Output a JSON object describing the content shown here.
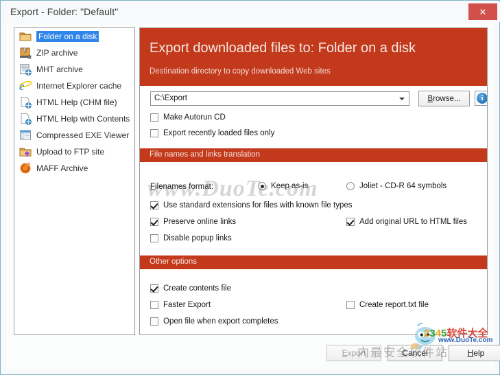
{
  "window": {
    "title": "Export - Folder: \"Default\"",
    "close_label": "✕",
    "accent_color": "#c3391c",
    "selection_color": "#2f86e8"
  },
  "sidebar": {
    "items": [
      {
        "label": "Folder on a disk",
        "icon": "folder-icon",
        "selected": true
      },
      {
        "label": "ZIP archive",
        "icon": "zip-archive-icon",
        "selected": false
      },
      {
        "label": "MHT archive",
        "icon": "mht-archive-icon",
        "selected": false
      },
      {
        "label": "Internet Explorer cache",
        "icon": "internet-explorer-icon",
        "selected": false
      },
      {
        "label": "HTML Help (CHM file)",
        "icon": "chm-file-icon",
        "selected": false
      },
      {
        "label": "HTML Help with Contents",
        "icon": "chm-contents-icon",
        "selected": false
      },
      {
        "label": "Compressed EXE Viewer",
        "icon": "exe-viewer-icon",
        "selected": false
      },
      {
        "label": "Upload to FTP site",
        "icon": "ftp-upload-icon",
        "selected": false
      },
      {
        "label": "MAFF Archive",
        "icon": "maff-archive-icon",
        "selected": false
      }
    ]
  },
  "panel": {
    "hero_title": "Export downloaded files to: Folder on a disk",
    "hero_subtitle": "Destination directory to copy downloaded Web sites",
    "destination": {
      "value": "C:\\Export",
      "placeholder": "C:\\Export",
      "browse_label": "Browse...",
      "info_label": "i"
    },
    "destination_options": [
      {
        "label": "Make Autorun CD",
        "checked": false
      },
      {
        "label": "Export recently loaded files only",
        "checked": false
      }
    ],
    "section_filenames": {
      "header": "File names and links translation",
      "filenames_format_label": "Filenames format:",
      "radios": [
        {
          "label": "Keep as-is",
          "selected": true
        },
        {
          "label": "Joliet - CD-R 64 symbols",
          "selected": false
        }
      ],
      "checkboxes_left": [
        {
          "label": "Use standard extensions for files with known file types",
          "checked": true
        },
        {
          "label": "Preserve online links",
          "checked": true
        },
        {
          "label": "Disable popup links",
          "checked": false
        }
      ],
      "checkboxes_right": [
        {
          "label": "Add original URL to HTML files",
          "checked": true
        }
      ]
    },
    "section_other": {
      "header": "Other options",
      "checkboxes_left": [
        {
          "label": "Create contents file",
          "checked": true
        },
        {
          "label": "Faster Export",
          "checked": false
        },
        {
          "label": "Open file when export completes",
          "checked": false
        }
      ],
      "checkboxes_right": [
        {
          "label": "Create report.txt file",
          "checked": false
        }
      ]
    }
  },
  "buttons": {
    "export": "Export",
    "cancel": "Cancel",
    "help": "Help",
    "export_disabled": true
  },
  "watermarks": {
    "center_text": "www.DuoTe.com",
    "brand_text": "2345软件大全",
    "brand_url": "www.DuoTe.com",
    "overlay_cn": "内最安全软件站"
  }
}
